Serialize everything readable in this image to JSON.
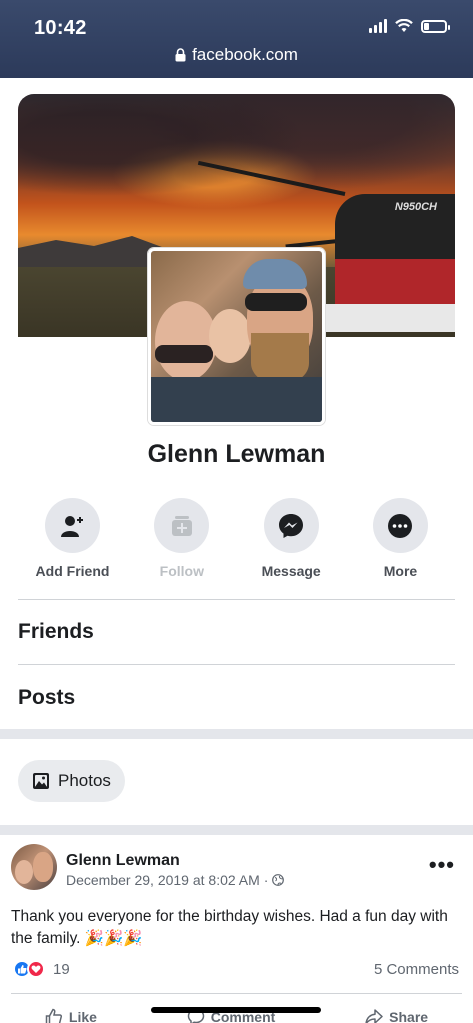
{
  "status_bar": {
    "time": "10:42",
    "url": "facebook.com",
    "signal_bars": 4,
    "battery_level": 0.25
  },
  "profile": {
    "name": "Glenn Lewman",
    "cover_registration": "N950CH"
  },
  "actions": [
    {
      "label": "Add Friend",
      "icon": "add-friend-icon",
      "enabled": true
    },
    {
      "label": "Follow",
      "icon": "follow-icon",
      "enabled": false
    },
    {
      "label": "Message",
      "icon": "messenger-icon",
      "enabled": true
    },
    {
      "label": "More",
      "icon": "more-icon",
      "enabled": true
    }
  ],
  "sections": {
    "friends": "Friends",
    "posts": "Posts"
  },
  "photos_button": "Photos",
  "post": {
    "author": "Glenn Lewman",
    "date": "December 29, 2019 at 8:02 AM",
    "separator": "·",
    "text": "Thank you everyone for the birthday wishes. Had a fun day with the family. 🎉🎉🎉",
    "reaction_count": "19",
    "comments": "5 Comments",
    "like_label": "Like",
    "comment_label": "Comment",
    "share_label": "Share"
  },
  "colors": {
    "accent": "#1877f2",
    "love": "#f0284a",
    "header": "#2c3a5a"
  }
}
